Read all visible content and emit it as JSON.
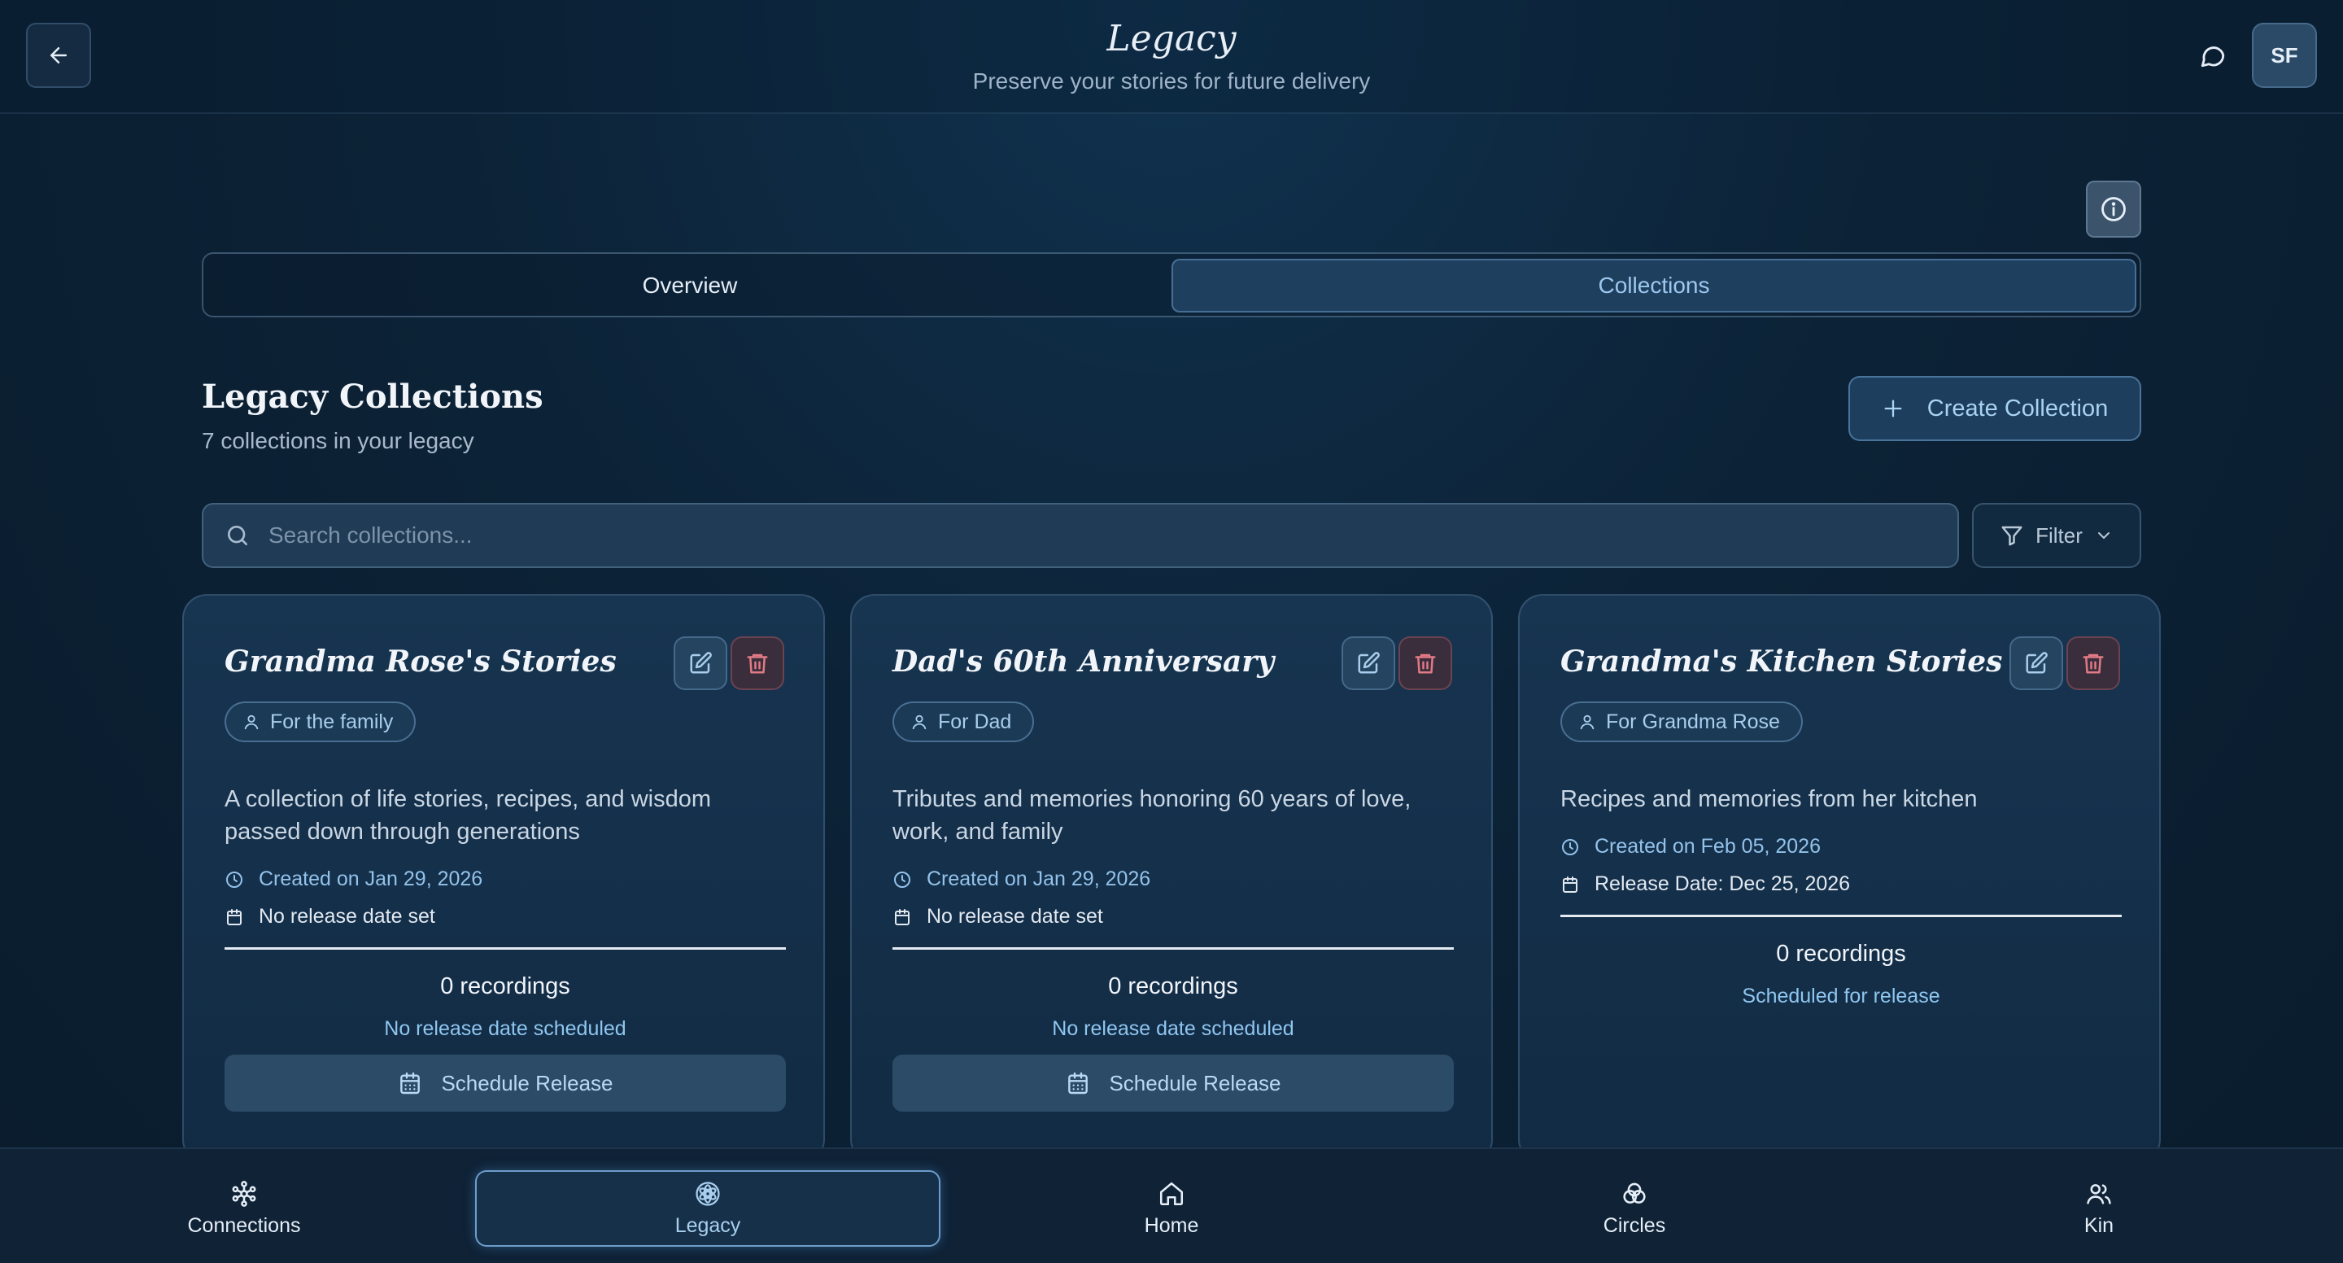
{
  "header": {
    "title": "Legacy",
    "subtitle": "Preserve your stories for future delivery",
    "avatar_initials": "SF"
  },
  "tabs": [
    {
      "label": "Overview",
      "active": false
    },
    {
      "label": "Collections",
      "active": true
    }
  ],
  "section": {
    "title": "Legacy Collections",
    "subtitle": "7 collections in your legacy",
    "create_label": "Create Collection"
  },
  "search": {
    "placeholder": "Search collections...",
    "value": "",
    "filter_label": "Filter"
  },
  "cards": [
    {
      "title": "Grandma Rose's Stories",
      "recipient": "For the family",
      "description": "A collection of life stories, recipes, and wisdom passed down through generations",
      "created": "Created on Jan 29, 2026",
      "release": "No release date set",
      "recordings": "0 recordings",
      "status": "No release date scheduled",
      "action_label": "Schedule Release"
    },
    {
      "title": "Dad's 60th Anniversary",
      "recipient": "For Dad",
      "description": "Tributes and memories honoring 60 years of love, work, and family",
      "created": "Created on Jan 29, 2026",
      "release": "No release date set",
      "recordings": "0 recordings",
      "status": "No release date scheduled",
      "action_label": "Schedule Release"
    },
    {
      "title": "Grandma's Kitchen Stories",
      "recipient": "For Grandma Rose",
      "description": "Recipes and memories from her kitchen",
      "created": "Created on Feb 05, 2026",
      "release": "Release Date: Dec 25, 2026",
      "recordings": "0 recordings",
      "status": "Scheduled for release"
    }
  ],
  "nav": [
    {
      "label": "Connections",
      "icon": "connections-icon",
      "active": false
    },
    {
      "label": "Legacy",
      "icon": "legacy-icon",
      "active": true
    },
    {
      "label": "Home",
      "icon": "home-icon",
      "active": false
    },
    {
      "label": "Circles",
      "icon": "circles-icon",
      "active": false
    },
    {
      "label": "Kin",
      "icon": "kin-icon",
      "active": false
    }
  ],
  "colors": {
    "accent": "#9cc8ef",
    "background": "#0c2236",
    "danger": "#e07a85"
  }
}
